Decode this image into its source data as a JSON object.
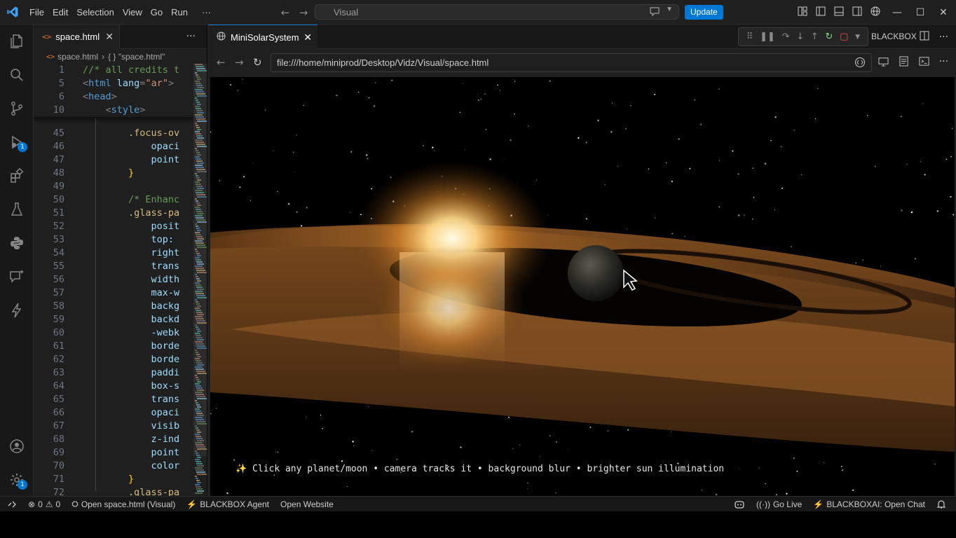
{
  "titlebar": {
    "menus": [
      "File",
      "Edit",
      "Selection",
      "View",
      "Go",
      "Run"
    ],
    "more": "···",
    "command_center": "Visual",
    "update_label": "Update"
  },
  "activity": {
    "run_badge": "1",
    "settings_badge": "1"
  },
  "editor": {
    "tab_label": "space.html",
    "breadcrumb_file": "space.html",
    "breadcrumb_symbol": "{ } \"space.html\"",
    "sticky": [
      {
        "n": "1",
        "parts": [
          {
            "c": "c-comment",
            "t": "//* all credits t"
          }
        ]
      },
      {
        "n": "5",
        "parts": [
          {
            "c": "c-punct",
            "t": "<"
          },
          {
            "c": "c-tag",
            "t": "html"
          },
          {
            "c": "c-attr",
            "t": " lang"
          },
          {
            "c": "c-punct",
            "t": "="
          },
          {
            "c": "c-str",
            "t": "\"ar\""
          },
          {
            "c": "c-punct",
            "t": ">"
          }
        ]
      },
      {
        "n": "6",
        "parts": [
          {
            "c": "c-punct",
            "t": "<"
          },
          {
            "c": "c-tag",
            "t": "head"
          },
          {
            "c": "c-punct",
            "t": ">"
          }
        ]
      },
      {
        "n": "10",
        "parts": [
          {
            "c": "c-punct",
            "t": "    <"
          },
          {
            "c": "c-tag",
            "t": "style"
          },
          {
            "c": "c-punct",
            "t": ">"
          }
        ]
      }
    ],
    "lines": [
      {
        "n": "45",
        "parts": [
          {
            "c": "c-sel",
            "t": "        .focus-ov"
          }
        ]
      },
      {
        "n": "46",
        "parts": [
          {
            "c": "c-prop",
            "t": "            opaci"
          }
        ]
      },
      {
        "n": "47",
        "parts": [
          {
            "c": "c-prop",
            "t": "            point"
          }
        ]
      },
      {
        "n": "48",
        "parts": [
          {
            "c": "c-brace",
            "t": "        }"
          }
        ]
      },
      {
        "n": "49",
        "parts": []
      },
      {
        "n": "50",
        "parts": [
          {
            "c": "c-comment",
            "t": "        /* Enhanc"
          }
        ]
      },
      {
        "n": "51",
        "parts": [
          {
            "c": "c-sel",
            "t": "        .glass-pa"
          }
        ]
      },
      {
        "n": "52",
        "parts": [
          {
            "c": "c-prop",
            "t": "            posit"
          }
        ]
      },
      {
        "n": "53",
        "parts": [
          {
            "c": "c-prop",
            "t": "            top: "
          }
        ]
      },
      {
        "n": "54",
        "parts": [
          {
            "c": "c-prop",
            "t": "            right"
          }
        ]
      },
      {
        "n": "55",
        "parts": [
          {
            "c": "c-prop",
            "t": "            trans"
          }
        ]
      },
      {
        "n": "56",
        "parts": [
          {
            "c": "c-prop",
            "t": "            width"
          }
        ]
      },
      {
        "n": "57",
        "parts": [
          {
            "c": "c-prop",
            "t": "            max-w"
          }
        ]
      },
      {
        "n": "58",
        "parts": [
          {
            "c": "c-prop",
            "t": "            backg"
          }
        ]
      },
      {
        "n": "59",
        "parts": [
          {
            "c": "c-prop",
            "t": "            backd"
          }
        ]
      },
      {
        "n": "60",
        "parts": [
          {
            "c": "c-prop",
            "t": "            -webk"
          }
        ]
      },
      {
        "n": "61",
        "parts": [
          {
            "c": "c-prop",
            "t": "            borde"
          }
        ]
      },
      {
        "n": "62",
        "parts": [
          {
            "c": "c-prop",
            "t": "            borde"
          }
        ]
      },
      {
        "n": "63",
        "parts": [
          {
            "c": "c-prop",
            "t": "            paddi"
          }
        ]
      },
      {
        "n": "64",
        "parts": [
          {
            "c": "c-prop",
            "t": "            box-s"
          }
        ]
      },
      {
        "n": "65",
        "parts": [
          {
            "c": "c-prop",
            "t": "            trans"
          }
        ]
      },
      {
        "n": "66",
        "parts": [
          {
            "c": "c-prop",
            "t": "            opaci"
          }
        ]
      },
      {
        "n": "67",
        "parts": [
          {
            "c": "c-prop",
            "t": "            visib"
          }
        ]
      },
      {
        "n": "68",
        "parts": [
          {
            "c": "c-prop",
            "t": "            z-ind"
          }
        ]
      },
      {
        "n": "69",
        "parts": [
          {
            "c": "c-prop",
            "t": "            point"
          }
        ]
      },
      {
        "n": "70",
        "parts": [
          {
            "c": "c-prop",
            "t": "            color"
          }
        ]
      },
      {
        "n": "71",
        "parts": [
          {
            "c": "c-brace",
            "t": "        }"
          }
        ]
      },
      {
        "n": "72",
        "parts": [
          {
            "c": "c-sel",
            "t": "        .glass-pa"
          }
        ]
      }
    ]
  },
  "preview": {
    "tab_label": "MiniSolarSystem",
    "blackbox_label": "BLACKBOX",
    "url": "file:///home/miniprod/Desktop/Vidz/Visual/space.html",
    "caption": "✨ Click any planet/moon • camera tracks it • background blur • brighter sun illumination"
  },
  "statusbar": {
    "errors": "0",
    "warnings": "0",
    "open_file": "Open space.html (Visual)",
    "agent": "BLACKBOX Agent",
    "open_website": "Open Website",
    "go_live": "Go Live",
    "open_chat": "BLACKBOXAI: Open Chat"
  },
  "colors": {
    "accent": "#0078d4",
    "titlebar_bg": "#1f1f1f",
    "activity_bg": "#181818",
    "editor_bg": "#1f1f1f",
    "status_bg": "#181818"
  }
}
